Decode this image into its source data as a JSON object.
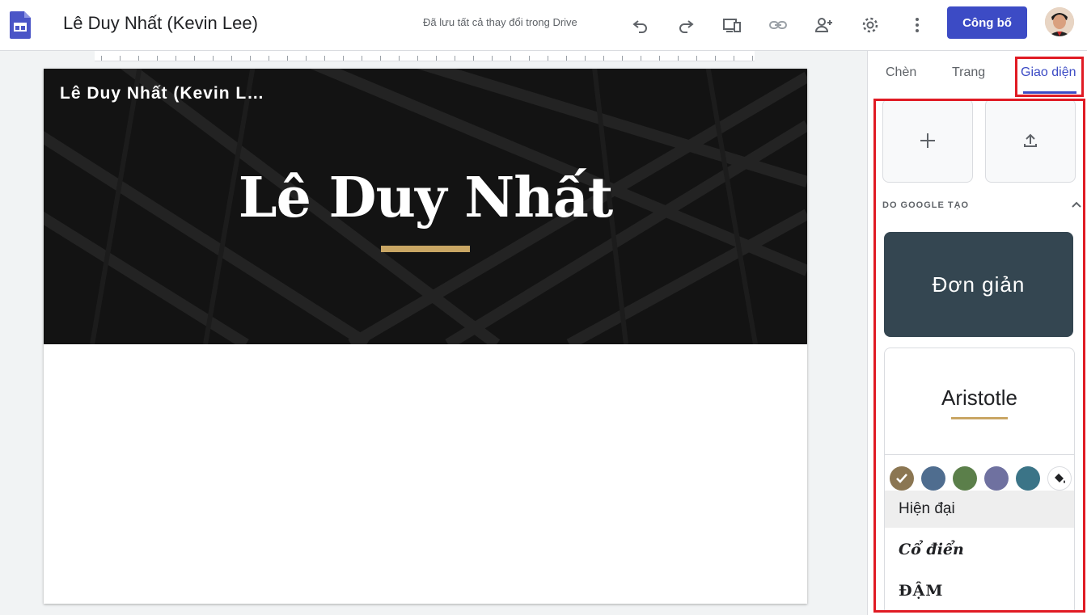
{
  "topbar": {
    "app_icon": "google-sites-icon",
    "doc_title": "Lê Duy Nhất (Kevin Lee)",
    "save_status": "Đã lưu tất cả thay đổi trong Drive",
    "icons": [
      "undo-icon",
      "redo-icon",
      "device-preview-icon",
      "link-icon",
      "add-person-icon",
      "gear-icon",
      "more-vert-icon"
    ],
    "publish_label": "Công bố",
    "avatar_icon": "user-avatar"
  },
  "page": {
    "site_name": "Lê Duy Nhất (Kevin L…",
    "hero_title": "Lê Duy Nhất"
  },
  "panel": {
    "tabs": [
      {
        "label": "Chèn",
        "active": false
      },
      {
        "label": "Trang",
        "active": false
      },
      {
        "label": "Giao diện",
        "active": true
      }
    ],
    "custom_cards": [
      "plus-icon",
      "upload-icon"
    ],
    "section_label": "DO GOOGLE TẠO",
    "themes": [
      {
        "name": "Đơn giản"
      },
      {
        "name": "Aristotle"
      }
    ],
    "swatches": [
      {
        "color": "#8b7652",
        "selected": true
      },
      {
        "color": "#4f6d8f",
        "selected": false
      },
      {
        "color": "#5b7f4a",
        "selected": false
      },
      {
        "color": "#6f71a0",
        "selected": false
      },
      {
        "color": "#3b7487",
        "selected": false
      }
    ],
    "paint_icon": "paint-bucket-icon",
    "font_styles": [
      {
        "label": "Hiện đại",
        "selected": true
      },
      {
        "label": "Cổ điển",
        "selected": false
      },
      {
        "label": "ĐẬM",
        "selected": false
      }
    ]
  },
  "colors": {
    "accent": "#3c4bc5",
    "highlight_box": "#e01b24",
    "gold": "#c9a664"
  }
}
